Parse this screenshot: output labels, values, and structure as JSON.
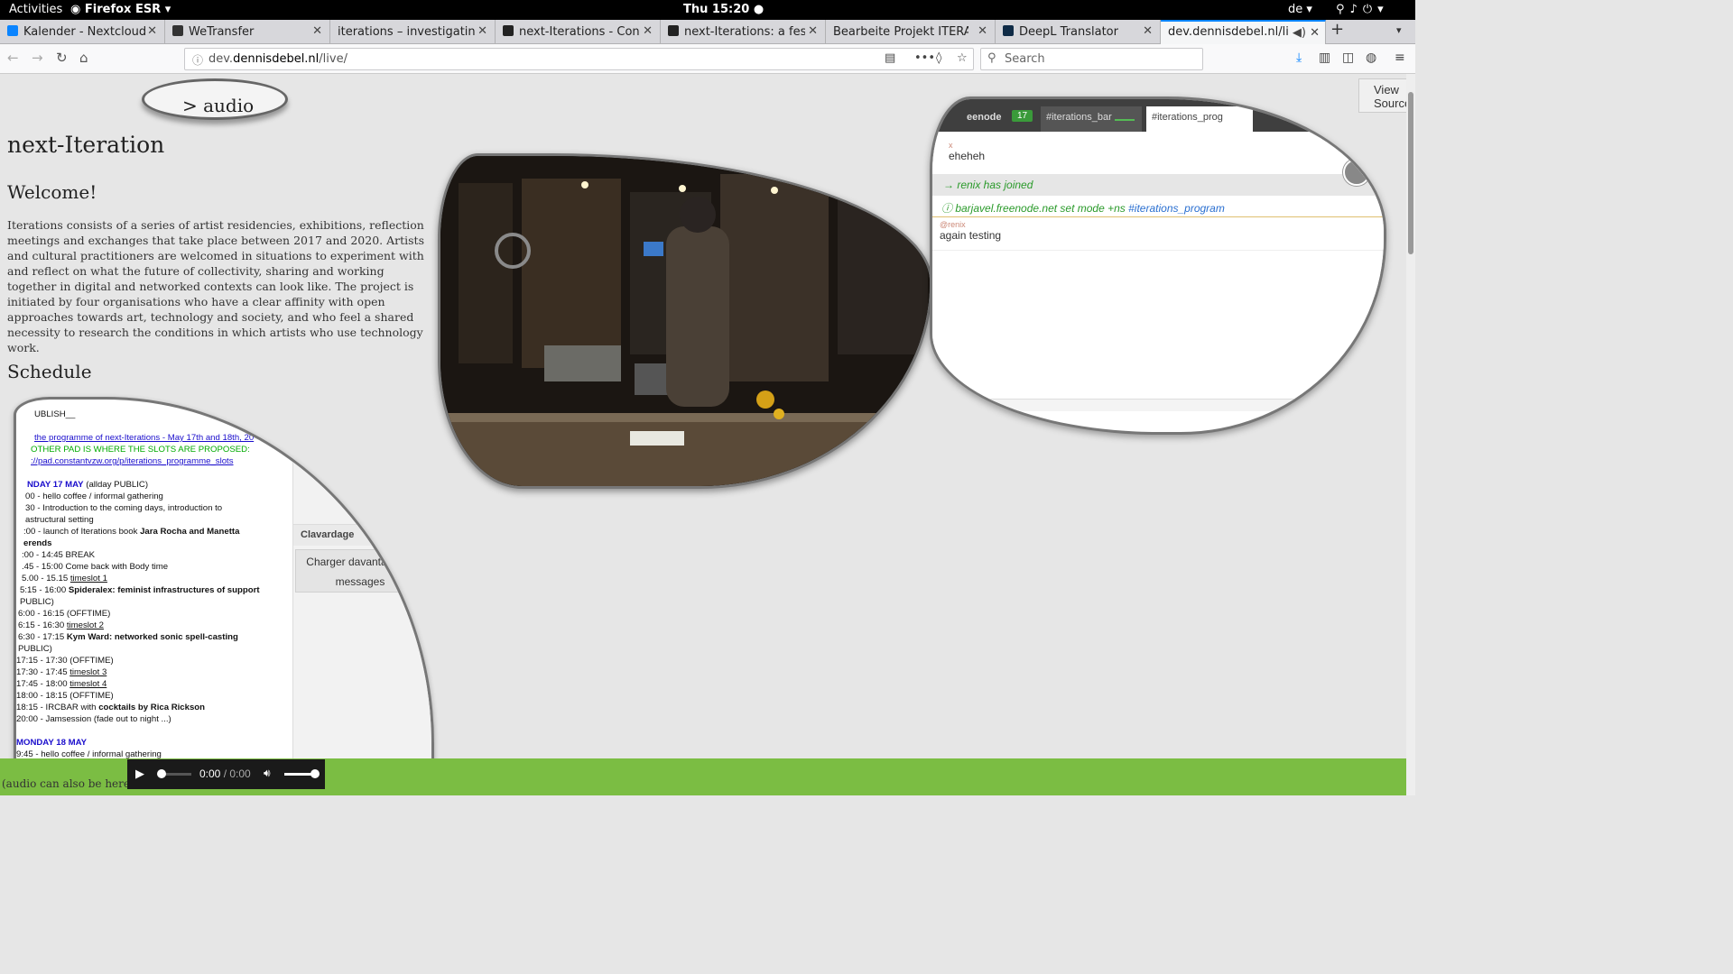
{
  "system": {
    "activities": "Activities",
    "app_name": "Firefox ESR",
    "clock": "Thu 15:20",
    "language": "de"
  },
  "tabs": [
    {
      "title": "Kalender - Nextcloud"
    },
    {
      "title": "WeTransfer"
    },
    {
      "title": "iterations – investigating the"
    },
    {
      "title": "next-Iterations - Constan"
    },
    {
      "title": "next-Iterations: a festive"
    },
    {
      "title": "Bearbeite Projekt ITERATIO"
    },
    {
      "title": "DeepL Translator"
    },
    {
      "title": "dev.dennisdebel.nl/live/"
    }
  ],
  "browser": {
    "url_prefix": "dev.",
    "url_host": "dennisdebel.nl",
    "url_path": "/live/",
    "search_placeholder": "Search"
  },
  "page": {
    "audio_button": "> audio",
    "view_source": "View Source",
    "title": "next-Iteration",
    "welcome": "Welcome!",
    "intro": "Iterations consists of a series of artist residencies, exhibitions, reflection meetings and exchanges that take place between 2017 and 2020. Artists and cultural practitioners are welcomed in situations to experiment with and reflect on what the future of collectivity, sharing and working together in digital and networked contexts can look like. The project is initiated by four organisations who have a clear affinity with open approaches towards art, technology and society, and who feel a shared necessity to research the conditions in which artists who use technology work.",
    "schedule_heading": "Schedule",
    "audio_note": "(audio can also be here)"
  },
  "pad": {
    "lines": [
      {
        "text": "UBLISH__",
        "style": "plain",
        "indent": 38
      },
      {
        "text": "",
        "style": "plain",
        "indent": 38
      },
      {
        "text": "the programme of next-Iterations - May 17th and 18th, 20",
        "style": "link",
        "indent": 38
      },
      {
        "text": "OTHER PAD IS WHERE THE SLOTS ARE PROPOSED:",
        "style": "green",
        "indent": 34
      },
      {
        "text": "://pad.constantvzw.org/p/iterations_programme_slots",
        "style": "link",
        "indent": 34
      },
      {
        "text": "",
        "style": "plain",
        "indent": 30
      },
      {
        "text": "NDAY 17 MAY",
        "tail": " (allday PUBLIC)",
        "style": "blue",
        "indent": 30
      },
      {
        "text": "00 - hello coffee / informal gathering",
        "style": "plain",
        "indent": 28
      },
      {
        "text": "30 - Introduction to the coming days, introduction to",
        "style": "plain",
        "indent": 28
      },
      {
        "text": "astructural setting",
        "style": "plain",
        "indent": 28
      },
      {
        "text": ":00 - launch of Iterations book ",
        "bold": "Jara Rocha and Manetta",
        "style": "mixed",
        "indent": 26
      },
      {
        "text": "",
        "bold": "erends",
        "style": "mixed",
        "indent": 26
      },
      {
        "text": ":00 - 14:45 BREAK",
        "style": "plain",
        "indent": 24
      },
      {
        "text": ".45 - 15:00 Come back with Body time",
        "style": "plain",
        "indent": 24
      },
      {
        "text": "5.00 - 15.15 ",
        "under": "timeslot 1",
        "style": "under",
        "indent": 24
      },
      {
        "text": "5:15 - 16:00 ",
        "bold": "Spideralex: feminist infrastructures of support",
        "style": "mixed",
        "indent": 22
      },
      {
        "text": "PUBLIC)",
        "style": "plain",
        "indent": 22
      },
      {
        "text": "6:00 - 16:15 (OFFTIME)",
        "style": "plain",
        "indent": 20
      },
      {
        "text": "6:15 - 16:30 ",
        "under": "timeslot 2",
        "style": "under",
        "indent": 20
      },
      {
        "text": "6:30 - 17:15 ",
        "bold": "Kym Ward: networked sonic spell-casting",
        "style": "mixed",
        "indent": 20
      },
      {
        "text": "PUBLIC)",
        "style": "plain",
        "indent": 20
      },
      {
        "text": "17:15 - 17:30 (OFFTIME)",
        "style": "plain",
        "indent": 18
      },
      {
        "text": "17:30 - 17:45 ",
        "under": "timeslot 3",
        "style": "under",
        "indent": 18
      },
      {
        "text": "17:45 - 18:00 ",
        "under": "timeslot 4",
        "style": "under",
        "indent": 18
      },
      {
        "text": "18:00 - 18:15 (OFFTIME)",
        "style": "plain",
        "indent": 18
      },
      {
        "text": "18:15 - IRCBAR with ",
        "bold": "cocktails by Rica Rickson",
        "style": "mixed",
        "indent": 18
      },
      {
        "text": "20:00 - Jamsession (fade out to night ...)",
        "style": "plain",
        "indent": 18
      },
      {
        "text": "",
        "style": "plain",
        "indent": 18
      },
      {
        "text": "MONDAY 18 MAY",
        "style": "blue",
        "indent": 18
      },
      {
        "text": "9:45 - hello coffee / informal gathering",
        "style": "plain",
        "indent": 18
      }
    ]
  },
  "chat": {
    "header": "Clavardage",
    "load_more": "Charger davantage de messages"
  },
  "irc": {
    "network": "eenode",
    "badge": "17",
    "tab2": "#iterations_bar",
    "tab3": "#iterations_prog",
    "messages": [
      {
        "nick": "x",
        "text": "eheheh",
        "kind": "normal"
      },
      {
        "text": "→ renix has joined",
        "kind": "join"
      },
      {
        "text": "ⓘ barjavel.freenode.net set mode +ns ",
        "channel": "#iterations_program",
        "kind": "mode"
      },
      {
        "nick": "@renix",
        "text": "again testing",
        "kind": "normal"
      }
    ]
  },
  "player": {
    "current": "0:00",
    "separator": " / ",
    "duration": "0:00",
    "progress": 0,
    "volume": 1
  },
  "colors": {
    "accent": "#0a84ff",
    "audio_bar": "#7bbd43",
    "pad_blue": "#1a0dcc",
    "pad_green": "#00aa00",
    "irc_join": "#2a9a2a",
    "irc_channel": "#2a6fd0"
  }
}
